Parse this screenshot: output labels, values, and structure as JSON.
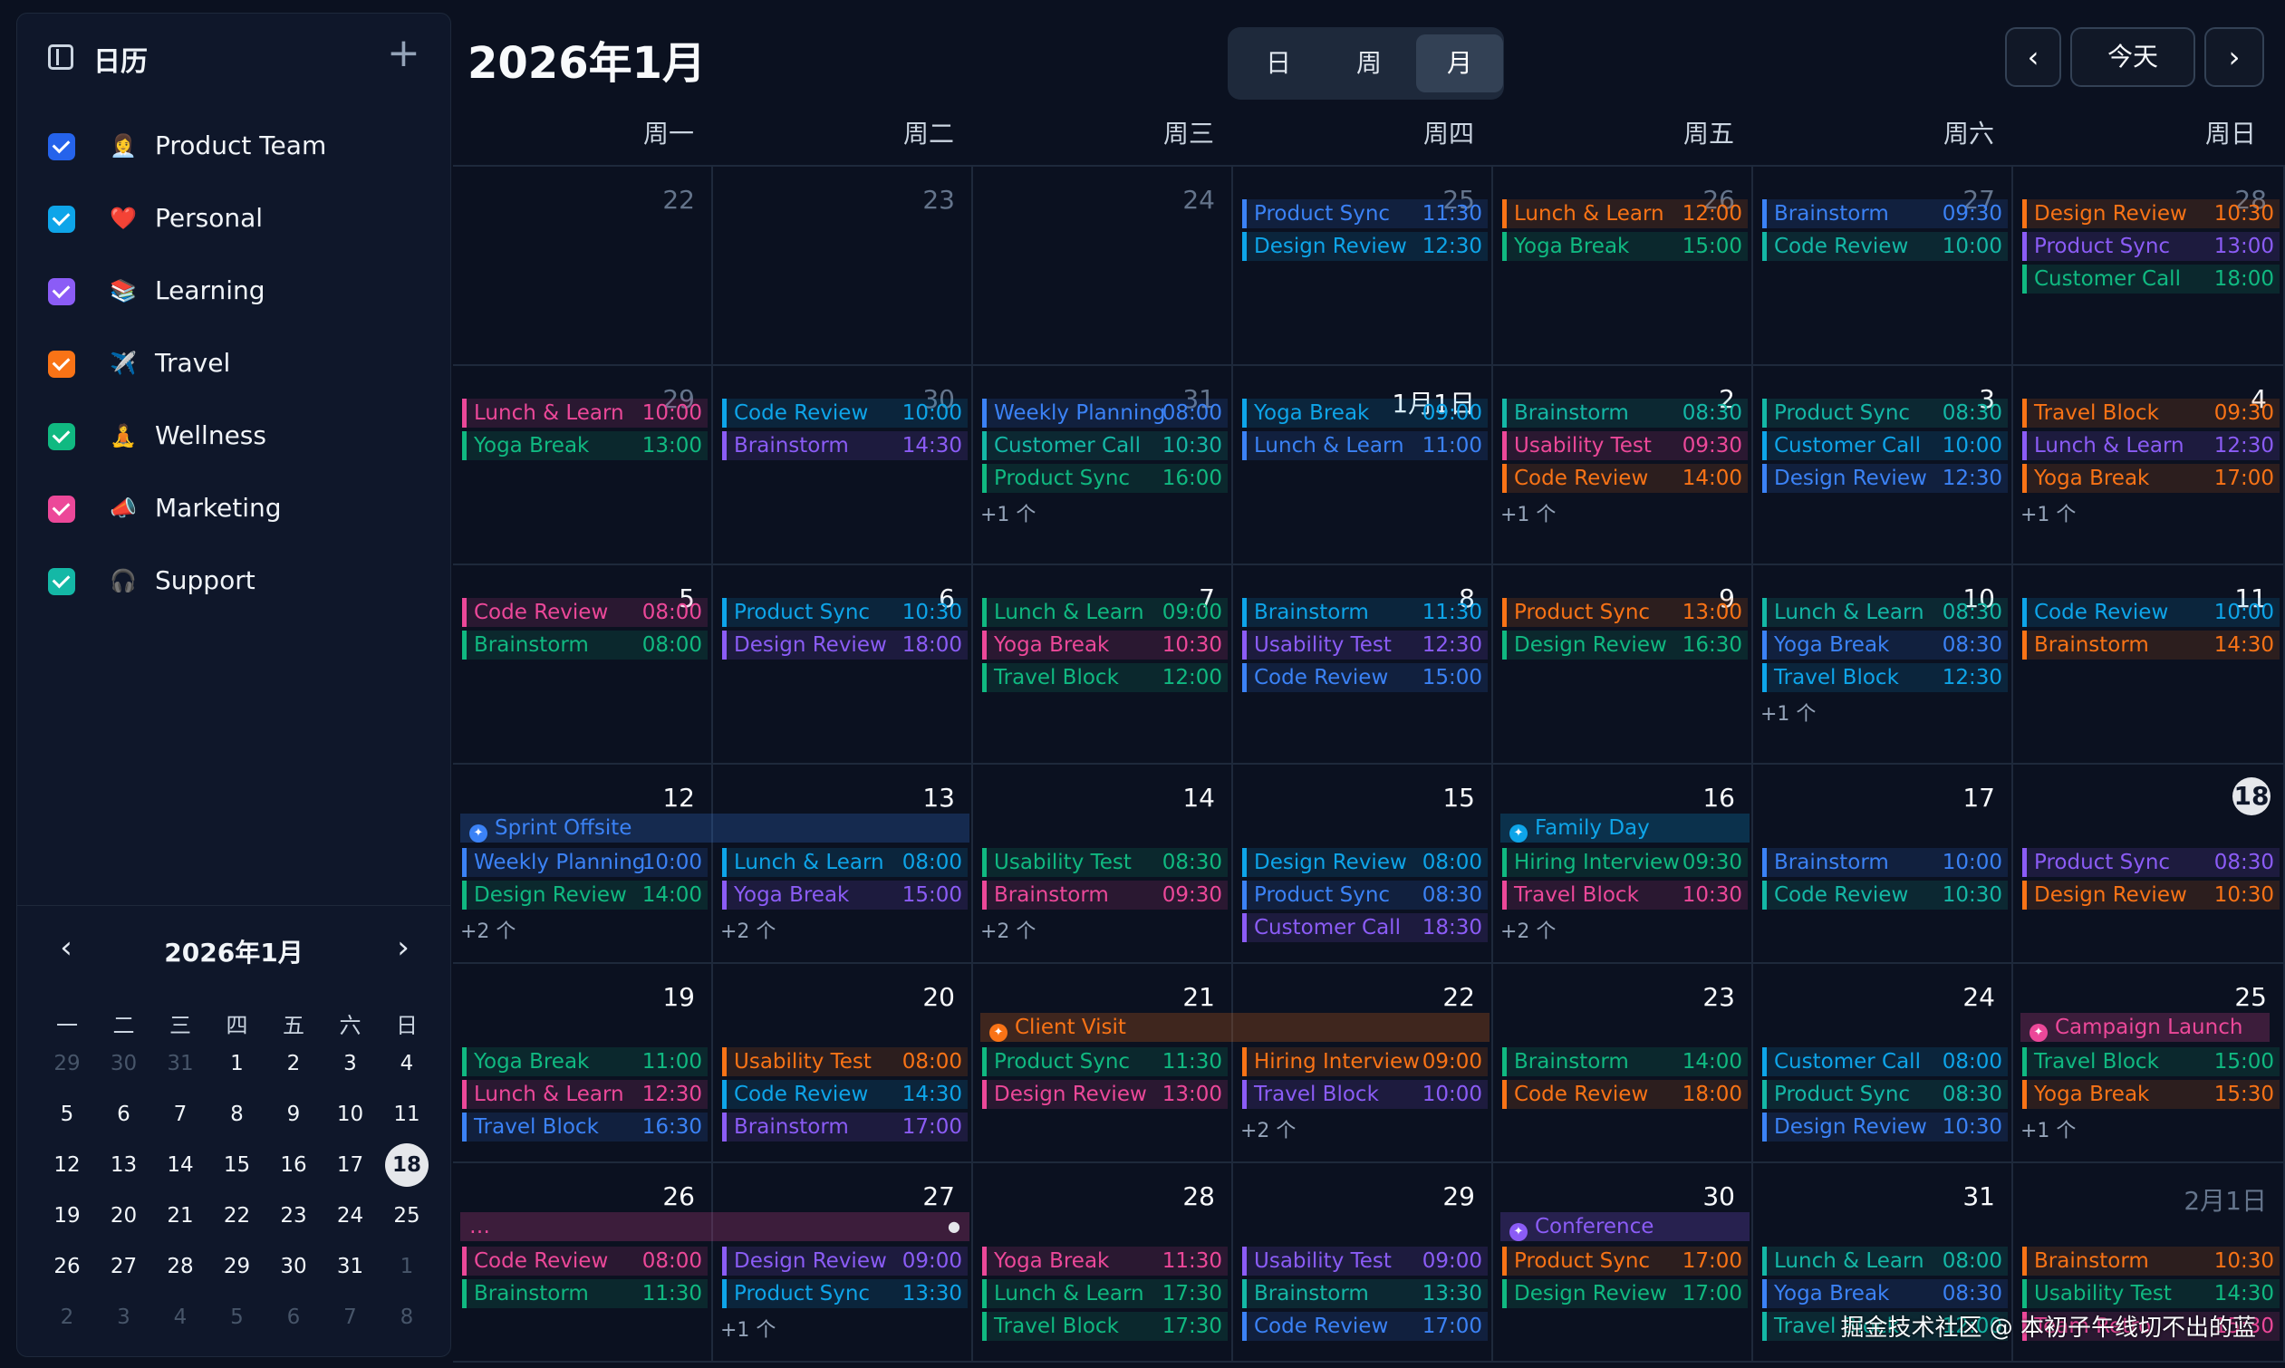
{
  "sidebar": {
    "title": "日历",
    "add_icon": "plus-icon",
    "calendars": [
      {
        "label": "Product Team",
        "emoji": "👩‍💼",
        "color": "#2563eb"
      },
      {
        "label": "Personal",
        "emoji": "❤️",
        "color": "#0ea5e9"
      },
      {
        "label": "Learning",
        "emoji": "📚",
        "color": "#8b5cf6"
      },
      {
        "label": "Travel",
        "emoji": "✈️",
        "color": "#f97316"
      },
      {
        "label": "Wellness",
        "emoji": "🧘",
        "color": "#10b981"
      },
      {
        "label": "Marketing",
        "emoji": "📣",
        "color": "#ec4899"
      },
      {
        "label": "Support",
        "emoji": "🎧",
        "color": "#14b8a6"
      }
    ]
  },
  "mini_calendar": {
    "title": "2026年1月",
    "weekdays": [
      "一",
      "二",
      "三",
      "四",
      "五",
      "六",
      "日"
    ],
    "days": [
      {
        "d": "29",
        "m": true
      },
      {
        "d": "30",
        "m": true
      },
      {
        "d": "31",
        "m": true
      },
      {
        "d": "1"
      },
      {
        "d": "2"
      },
      {
        "d": "3"
      },
      {
        "d": "4"
      },
      {
        "d": "5"
      },
      {
        "d": "6"
      },
      {
        "d": "7"
      },
      {
        "d": "8"
      },
      {
        "d": "9"
      },
      {
        "d": "10"
      },
      {
        "d": "11"
      },
      {
        "d": "12"
      },
      {
        "d": "13"
      },
      {
        "d": "14"
      },
      {
        "d": "15"
      },
      {
        "d": "16"
      },
      {
        "d": "17"
      },
      {
        "d": "18",
        "t": true
      },
      {
        "d": "19"
      },
      {
        "d": "20"
      },
      {
        "d": "21"
      },
      {
        "d": "22"
      },
      {
        "d": "23"
      },
      {
        "d": "24"
      },
      {
        "d": "25"
      },
      {
        "d": "26"
      },
      {
        "d": "27"
      },
      {
        "d": "28"
      },
      {
        "d": "29"
      },
      {
        "d": "30"
      },
      {
        "d": "31"
      },
      {
        "d": "1",
        "m": true
      },
      {
        "d": "2",
        "m": true
      },
      {
        "d": "3",
        "m": true
      },
      {
        "d": "4",
        "m": true
      },
      {
        "d": "5",
        "m": true
      },
      {
        "d": "6",
        "m": true
      },
      {
        "d": "7",
        "m": true
      },
      {
        "d": "8",
        "m": true
      }
    ]
  },
  "header": {
    "title": "2026年1月",
    "views": [
      "日",
      "周",
      "月"
    ],
    "active_view": "月",
    "prev_icon": "chevron-left-icon",
    "today_label": "今天",
    "next_icon": "chevron-right-icon"
  },
  "weekdays": [
    "周一",
    "周二",
    "周三",
    "周四",
    "周五",
    "周六",
    "周日"
  ],
  "colors": {
    "product_team": "#3b82f6",
    "personal": "#0ea5e9",
    "learning": "#8b5cf6",
    "travel": "#f97316",
    "wellness": "#10b981",
    "marketing": "#ec4899",
    "support": "#14b8a6"
  },
  "weeks": [
    {
      "days": [
        {
          "label": "22",
          "muted": true,
          "events": []
        },
        {
          "label": "23",
          "muted": true,
          "events": []
        },
        {
          "label": "24",
          "muted": true,
          "events": []
        },
        {
          "label": "25",
          "muted": true,
          "events": [
            {
              "t": "Product Sync",
              "tm": "11:30",
              "c": "product_team"
            },
            {
              "t": "Design Review",
              "tm": "12:30",
              "c": "personal"
            }
          ]
        },
        {
          "label": "26",
          "muted": true,
          "events": [
            {
              "t": "Lunch & Learn",
              "tm": "12:00",
              "c": "travel"
            },
            {
              "t": "Yoga Break",
              "tm": "15:00",
              "c": "wellness"
            }
          ]
        },
        {
          "label": "27",
          "muted": true,
          "events": [
            {
              "t": "Brainstorm",
              "tm": "09:30",
              "c": "product_team"
            },
            {
              "t": "Code Review",
              "tm": "10:00",
              "c": "support"
            }
          ]
        },
        {
          "label": "28",
          "muted": true,
          "events": [
            {
              "t": "Design Review",
              "tm": "10:30",
              "c": "travel"
            },
            {
              "t": "Product Sync",
              "tm": "13:00",
              "c": "learning"
            },
            {
              "t": "Customer Call",
              "tm": "18:00",
              "c": "wellness"
            }
          ]
        }
      ]
    },
    {
      "days": [
        {
          "label": "29",
          "muted": true,
          "events": [
            {
              "t": "Lunch & Learn",
              "tm": "10:00",
              "c": "marketing"
            },
            {
              "t": "Yoga Break",
              "tm": "13:00",
              "c": "wellness"
            }
          ]
        },
        {
          "label": "30",
          "muted": true,
          "events": [
            {
              "t": "Code Review",
              "tm": "10:00",
              "c": "personal"
            },
            {
              "t": "Brainstorm",
              "tm": "14:30",
              "c": "learning"
            }
          ]
        },
        {
          "label": "31",
          "muted": true,
          "events": [
            {
              "t": "Weekly Planning",
              "tm": "08:00",
              "c": "product_team"
            },
            {
              "t": "Customer Call",
              "tm": "10:30",
              "c": "support"
            },
            {
              "t": "Product Sync",
              "tm": "16:00",
              "c": "wellness"
            }
          ],
          "more": "+1 个"
        },
        {
          "label": "1月1日",
          "events": [
            {
              "t": "Yoga Break",
              "tm": "09:00",
              "c": "personal"
            },
            {
              "t": "Lunch & Learn",
              "tm": "11:00",
              "c": "product_team"
            }
          ]
        },
        {
          "label": "2",
          "events": [
            {
              "t": "Brainstorm",
              "tm": "08:30",
              "c": "support"
            },
            {
              "t": "Usability Test",
              "tm": "09:30",
              "c": "marketing"
            },
            {
              "t": "Code Review",
              "tm": "14:00",
              "c": "travel"
            }
          ],
          "more": "+1 个"
        },
        {
          "label": "3",
          "events": [
            {
              "t": "Product Sync",
              "tm": "08:30",
              "c": "support"
            },
            {
              "t": "Customer Call",
              "tm": "10:00",
              "c": "personal"
            },
            {
              "t": "Design Review",
              "tm": "12:30",
              "c": "product_team"
            }
          ]
        },
        {
          "label": "4",
          "events": [
            {
              "t": "Travel Block",
              "tm": "09:30",
              "c": "travel"
            },
            {
              "t": "Lunch & Learn",
              "tm": "12:30",
              "c": "learning"
            },
            {
              "t": "Yoga Break",
              "tm": "17:00",
              "c": "travel"
            }
          ],
          "more": "+1 个"
        }
      ]
    },
    {
      "days": [
        {
          "label": "5",
          "events": [
            {
              "t": "Code Review",
              "tm": "08:00",
              "c": "marketing"
            },
            {
              "t": "Brainstorm",
              "tm": "08:00",
              "c": "wellness"
            }
          ]
        },
        {
          "label": "6",
          "events": [
            {
              "t": "Product Sync",
              "tm": "10:30",
              "c": "personal"
            },
            {
              "t": "Design Review",
              "tm": "18:00",
              "c": "learning"
            }
          ]
        },
        {
          "label": "7",
          "events": [
            {
              "t": "Lunch & Learn",
              "tm": "09:00",
              "c": "wellness"
            },
            {
              "t": "Yoga Break",
              "tm": "10:30",
              "c": "marketing"
            },
            {
              "t": "Travel Block",
              "tm": "12:00",
              "c": "wellness"
            }
          ]
        },
        {
          "label": "8",
          "events": [
            {
              "t": "Brainstorm",
              "tm": "11:30",
              "c": "personal"
            },
            {
              "t": "Usability Test",
              "tm": "12:30",
              "c": "learning"
            },
            {
              "t": "Code Review",
              "tm": "15:00",
              "c": "product_team"
            }
          ]
        },
        {
          "label": "9",
          "events": [
            {
              "t": "Product Sync",
              "tm": "13:00",
              "c": "travel"
            },
            {
              "t": "Design Review",
              "tm": "16:30",
              "c": "wellness"
            }
          ]
        },
        {
          "label": "10",
          "events": [
            {
              "t": "Lunch & Learn",
              "tm": "08:30",
              "c": "support"
            },
            {
              "t": "Yoga Break",
              "tm": "08:30",
              "c": "product_team"
            },
            {
              "t": "Travel Block",
              "tm": "12:30",
              "c": "personal"
            }
          ],
          "more": "+1 个"
        },
        {
          "label": "11",
          "events": [
            {
              "t": "Code Review",
              "tm": "10:00",
              "c": "personal"
            },
            {
              "t": "Brainstorm",
              "tm": "14:30",
              "c": "travel"
            }
          ]
        }
      ]
    },
    {
      "days": [
        {
          "label": "12",
          "events": [
            {
              "t": "Weekly Planning",
              "tm": "10:00",
              "c": "product_team"
            },
            {
              "t": "Design Review",
              "tm": "14:00",
              "c": "wellness"
            }
          ],
          "more": "+2 个"
        },
        {
          "label": "13",
          "events": [
            {
              "t": "Lunch & Learn",
              "tm": "08:00",
              "c": "personal"
            },
            {
              "t": "Yoga Break",
              "tm": "15:00",
              "c": "learning"
            }
          ],
          "more": "+2 个"
        },
        {
          "label": "14",
          "events": [
            {
              "t": "Usability Test",
              "tm": "08:30",
              "c": "wellness"
            },
            {
              "t": "Brainstorm",
              "tm": "09:30",
              "c": "marketing"
            }
          ],
          "more": "+2 个"
        },
        {
          "label": "15",
          "events": [
            {
              "t": "Design Review",
              "tm": "08:00",
              "c": "personal"
            },
            {
              "t": "Product Sync",
              "tm": "08:30",
              "c": "product_team"
            },
            {
              "t": "Customer Call",
              "tm": "18:30",
              "c": "learning"
            }
          ]
        },
        {
          "label": "16",
          "events": [
            {
              "t": "Hiring Interview",
              "tm": "09:30",
              "c": "wellness"
            },
            {
              "t": "Travel Block",
              "tm": "10:30",
              "c": "marketing"
            }
          ],
          "more": "+2 个"
        },
        {
          "label": "17",
          "events": [
            {
              "t": "Brainstorm",
              "tm": "10:00",
              "c": "product_team"
            },
            {
              "t": "Code Review",
              "tm": "10:30",
              "c": "support"
            }
          ]
        },
        {
          "label": "18",
          "today": true,
          "events": [
            {
              "t": "Product Sync",
              "tm": "08:30",
              "c": "learning"
            },
            {
              "t": "Design Review",
              "tm": "10:30",
              "c": "travel"
            }
          ]
        }
      ],
      "allday": [
        {
          "t": "Sprint Offsite",
          "c": "product_team",
          "start": 0,
          "span": 2,
          "icon": "calendar-icon"
        },
        {
          "t": "Family Day",
          "c": "personal",
          "start": 4,
          "span": 1,
          "icon": "home-icon"
        }
      ]
    },
    {
      "days": [
        {
          "label": "19",
          "events": [
            {
              "t": "Yoga Break",
              "tm": "11:00",
              "c": "wellness"
            },
            {
              "t": "Lunch & Learn",
              "tm": "12:30",
              "c": "marketing"
            },
            {
              "t": "Travel Block",
              "tm": "16:30",
              "c": "product_team"
            }
          ]
        },
        {
          "label": "20",
          "events": [
            {
              "t": "Usability Test",
              "tm": "08:00",
              "c": "travel"
            },
            {
              "t": "Code Review",
              "tm": "14:30",
              "c": "personal"
            },
            {
              "t": "Brainstorm",
              "tm": "17:00",
              "c": "learning"
            }
          ]
        },
        {
          "label": "21",
          "events": [
            {
              "t": "Product Sync",
              "tm": "11:30",
              "c": "wellness"
            },
            {
              "t": "Design Review",
              "tm": "13:00",
              "c": "marketing"
            }
          ]
        },
        {
          "label": "22",
          "events": [
            {
              "t": "Hiring Interview",
              "tm": "09:00",
              "c": "travel"
            },
            {
              "t": "Travel Block",
              "tm": "10:00",
              "c": "learning"
            }
          ],
          "more": "+2 个"
        },
        {
          "label": "23",
          "events": [
            {
              "t": "Brainstorm",
              "tm": "14:00",
              "c": "wellness"
            },
            {
              "t": "Code Review",
              "tm": "18:00",
              "c": "travel"
            }
          ]
        },
        {
          "label": "24",
          "events": [
            {
              "t": "Customer Call",
              "tm": "08:00",
              "c": "personal"
            },
            {
              "t": "Product Sync",
              "tm": "08:30",
              "c": "support"
            },
            {
              "t": "Design Review",
              "tm": "10:30",
              "c": "product_team"
            }
          ]
        },
        {
          "label": "25",
          "events": [
            {
              "t": "Travel Block",
              "tm": "15:00",
              "c": "wellness"
            },
            {
              "t": "Yoga Break",
              "tm": "15:30",
              "c": "travel"
            }
          ],
          "more": "+1 个"
        }
      ],
      "allday": [
        {
          "t": "Client Visit",
          "c": "travel",
          "start": 2,
          "span": 2,
          "icon": "briefcase-icon"
        },
        {
          "t": "Campaign Launch",
          "c": "marketing",
          "start": 6,
          "span": 1,
          "icon": "megaphone-icon"
        }
      ]
    },
    {
      "days": [
        {
          "label": "26",
          "events": [
            {
              "t": "Code Review",
              "tm": "08:00",
              "c": "marketing"
            },
            {
              "t": "Brainstorm",
              "tm": "11:30",
              "c": "wellness"
            }
          ]
        },
        {
          "label": "27",
          "events": [
            {
              "t": "Design Review",
              "tm": "09:00",
              "c": "learning"
            },
            {
              "t": "Product Sync",
              "tm": "13:30",
              "c": "personal"
            }
          ],
          "more": "+1 个"
        },
        {
          "label": "28",
          "events": [
            {
              "t": "Yoga Break",
              "tm": "11:30",
              "c": "marketing"
            },
            {
              "t": "Lunch & Learn",
              "tm": "17:30",
              "c": "wellness"
            },
            {
              "t": "Travel Block",
              "tm": "17:30",
              "c": "wellness"
            }
          ]
        },
        {
          "label": "29",
          "events": [
            {
              "t": "Usability Test",
              "tm": "09:00",
              "c": "learning"
            },
            {
              "t": "Brainstorm",
              "tm": "13:30",
              "c": "support"
            },
            {
              "t": "Code Review",
              "tm": "17:00",
              "c": "product_team"
            }
          ]
        },
        {
          "label": "30",
          "events": [
            {
              "t": "Product Sync",
              "tm": "17:00",
              "c": "travel"
            },
            {
              "t": "Design Review",
              "tm": "17:00",
              "c": "wellness"
            }
          ]
        },
        {
          "label": "31",
          "events": [
            {
              "t": "Lunch & Learn",
              "tm": "08:00",
              "c": "support"
            },
            {
              "t": "Yoga Break",
              "tm": "08:30",
              "c": "product_team"
            },
            {
              "t": "Travel Block",
              "tm": "12:00",
              "c": "support"
            }
          ]
        },
        {
          "label": "2月1日",
          "muted": true,
          "events": [
            {
              "t": "Brainstorm",
              "tm": "10:30",
              "c": "travel"
            },
            {
              "t": "Usability Test",
              "tm": "14:30",
              "c": "wellness"
            },
            {
              "t": "Team Retro",
              "tm": "15:30",
              "c": "marketing"
            }
          ]
        }
      ],
      "allday": [
        {
          "t": "…",
          "c": "marketing",
          "start": 0,
          "span": 2,
          "icon": "",
          "dot": "●"
        },
        {
          "t": "Conference",
          "c": "learning",
          "start": 4,
          "span": 1,
          "icon": "star-icon"
        }
      ]
    }
  ],
  "watermark": "掘金技术社区 @ 本初子午线切不出的蓝"
}
